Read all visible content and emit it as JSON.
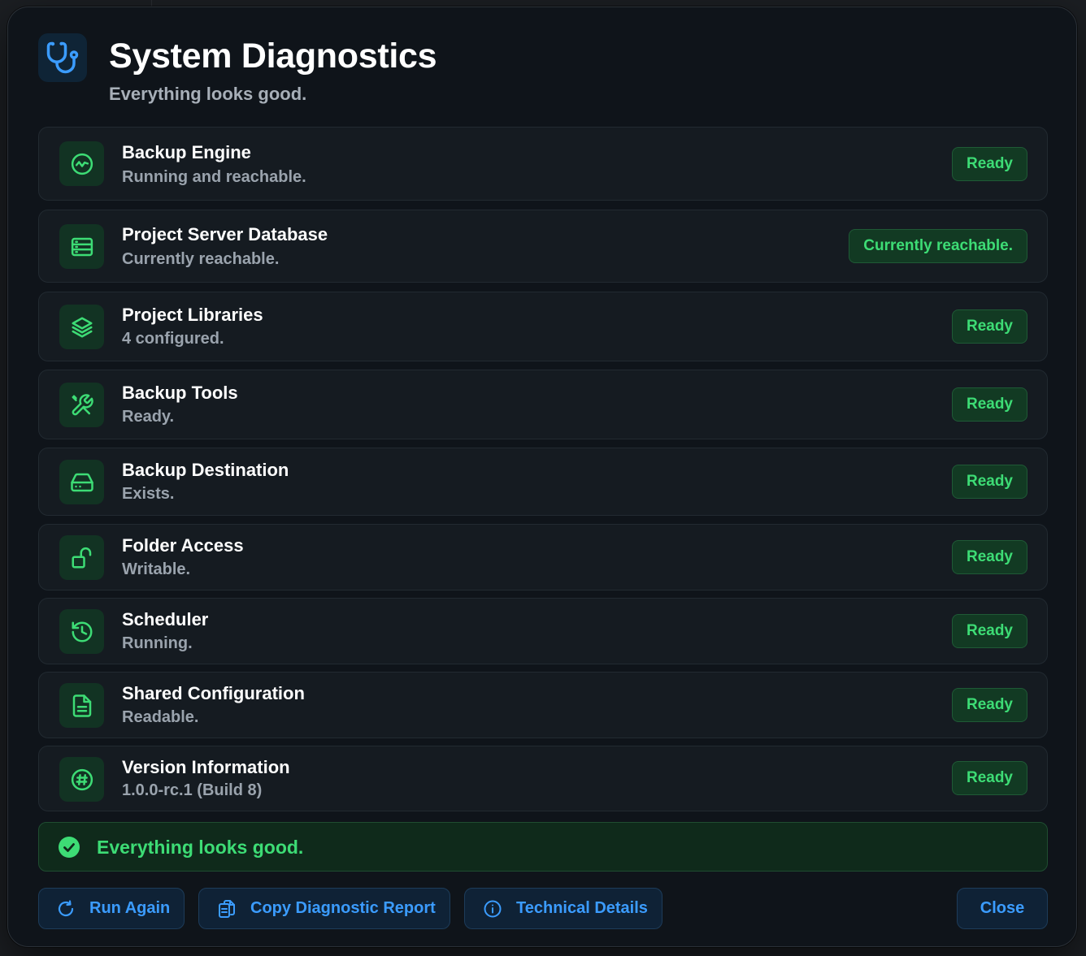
{
  "header": {
    "title": "System Diagnostics",
    "subtitle": "Everything looks good.",
    "icon": "stethoscope-icon",
    "accent_color": "#3b9cff"
  },
  "rows": [
    {
      "name": "Backup Engine",
      "detail": "Running and reachable.",
      "status": "Ready",
      "icon": "activity-icon"
    },
    {
      "name": "Project Server Database",
      "detail": "Currently reachable.",
      "status": "Currently reachable.",
      "icon": "server-icon"
    },
    {
      "name": "Project Libraries",
      "detail": "4 configured.",
      "status": "Ready",
      "icon": "layers-icon"
    },
    {
      "name": "Backup Tools",
      "detail": "Ready.",
      "status": "Ready",
      "icon": "tools-icon"
    },
    {
      "name": "Backup Destination",
      "detail": "Exists.",
      "status": "Ready",
      "icon": "hard-drive-icon"
    },
    {
      "name": "Folder Access",
      "detail": "Writable.",
      "status": "Ready",
      "icon": "unlock-icon"
    },
    {
      "name": "Scheduler",
      "detail": "Running.",
      "status": "Ready",
      "icon": "history-icon"
    },
    {
      "name": "Shared Configuration",
      "detail": "Readable.",
      "status": "Ready",
      "icon": "file-icon"
    },
    {
      "name": "Version Information",
      "detail": "1.0.0-rc.1 (Build 8)",
      "status": "Ready",
      "icon": "hash-icon"
    }
  ],
  "summary": {
    "text": "Everything looks good.",
    "icon": "check-circle-icon",
    "color": "#3ddc75"
  },
  "buttons": {
    "run_again": "Run Again",
    "copy_report": "Copy Diagnostic Report",
    "technical_details": "Technical Details",
    "close": "Close"
  },
  "colors": {
    "status_green": "#3ddc75",
    "button_blue": "#3b9cff",
    "dialog_bg": "#0f141a"
  }
}
